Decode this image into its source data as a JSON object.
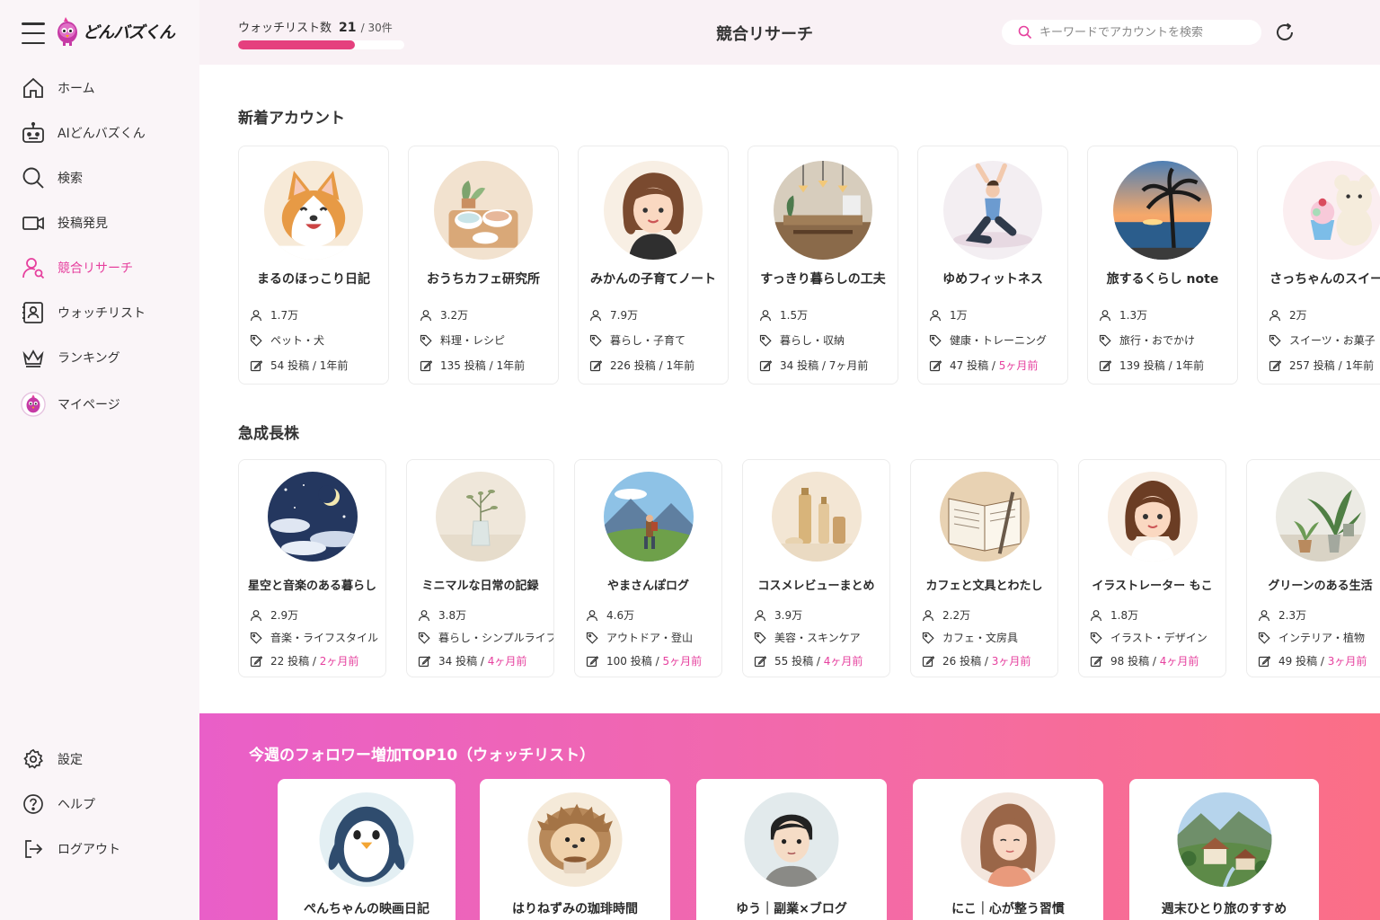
{
  "app": {
    "logo_text": "どんバズくん"
  },
  "sidebar": {
    "items": [
      {
        "label": "ホーム",
        "icon": "home-icon"
      },
      {
        "label": "AIどんバズくん",
        "icon": "robot-icon"
      },
      {
        "label": "検索",
        "icon": "search-icon"
      },
      {
        "label": "投稿発見",
        "icon": "video-icon"
      },
      {
        "label": "競合リサーチ",
        "icon": "user-search-icon",
        "active": true
      },
      {
        "label": "ウォッチリスト",
        "icon": "contact-book-icon"
      },
      {
        "label": "ランキング",
        "icon": "crown-icon"
      },
      {
        "label": "マイページ",
        "icon": "avatar-icon"
      }
    ],
    "bottom_items": [
      {
        "label": "設定",
        "icon": "gear-icon"
      },
      {
        "label": "ヘルプ",
        "icon": "help-icon"
      },
      {
        "label": "ログアウト",
        "icon": "logout-icon"
      }
    ]
  },
  "header": {
    "watch_label": "ウォッチリスト数",
    "watch_count": "21",
    "watch_total": "/ 30件",
    "watch_progress": 0.7,
    "title": "競合リサーチ",
    "search_placeholder": "キーワードでアカウントを検索"
  },
  "new_accounts": {
    "title": "新着アカウント",
    "cards": [
      {
        "name": "まるのほっこり日記",
        "followers": "1.7万",
        "tags": "ペット・犬",
        "posts": "54 投稿",
        "sep": "/",
        "age": "1年前",
        "age_highlight": false
      },
      {
        "name": "おうちカフェ研究所",
        "followers": "3.2万",
        "tags": "料理・レシピ",
        "posts": "135 投稿",
        "sep": "/",
        "age": "1年前",
        "age_highlight": false
      },
      {
        "name": "みかんの子育てノート",
        "followers": "7.9万",
        "tags": "暮らし・子育て",
        "posts": "226 投稿",
        "sep": "/",
        "age": "1年前",
        "age_highlight": false
      },
      {
        "name": "すっきり暮らしの工夫",
        "followers": "1.5万",
        "tags": "暮らし・収納",
        "posts": "34 投稿",
        "sep": "/",
        "age": "7ヶ月前",
        "age_highlight": false
      },
      {
        "name": "ゆめフィットネス",
        "followers": "1万",
        "tags": "健康・トレーニング",
        "posts": "47 投稿",
        "sep": "/",
        "age": "5ヶ月前",
        "age_highlight": true
      },
      {
        "name": "旅するくらし note",
        "followers": "1.3万",
        "tags": "旅行・おでかけ",
        "posts": "139 投稿",
        "sep": "/",
        "age": "1年前",
        "age_highlight": false
      },
      {
        "name": "さっちゃんのスイーツ",
        "followers": "2万",
        "tags": "スイーツ・お菓子",
        "posts": "257 投稿",
        "sep": "/",
        "age": "1年前",
        "age_highlight": false
      }
    ]
  },
  "rapid_growth": {
    "title": "急成長株",
    "cards": [
      {
        "name": "星空と音楽のある暮らし",
        "followers": "2.9万",
        "tags": "音楽・ライフスタイル",
        "posts": "22 投稿",
        "sep": "/",
        "age": "2ヶ月前",
        "age_highlight": true
      },
      {
        "name": "ミニマルな日常の記録",
        "followers": "3.8万",
        "tags": "暮らし・シンプルライフ",
        "posts": "34 投稿",
        "sep": "/",
        "age": "4ヶ月前",
        "age_highlight": true
      },
      {
        "name": "やまさんぽログ",
        "followers": "4.6万",
        "tags": "アウトドア・登山",
        "posts": "100 投稿",
        "sep": "/",
        "age": "5ヶ月前",
        "age_highlight": true
      },
      {
        "name": "コスメレビューまとめ",
        "followers": "3.9万",
        "tags": "美容・スキンケア",
        "posts": "55 投稿",
        "sep": "/",
        "age": "4ヶ月前",
        "age_highlight": true
      },
      {
        "name": "カフェと文具とわたし",
        "followers": "2.2万",
        "tags": "カフェ・文房具",
        "posts": "26 投稿",
        "sep": "/",
        "age": "3ヶ月前",
        "age_highlight": true
      },
      {
        "name": "イラストレーター もこ",
        "followers": "1.8万",
        "tags": "イラスト・デザイン",
        "posts": "98 投稿",
        "sep": "/",
        "age": "4ヶ月前",
        "age_highlight": true
      },
      {
        "name": "グリーンのある生活",
        "followers": "2.3万",
        "tags": "インテリア・植物",
        "posts": "49 投稿",
        "sep": "/",
        "age": "3ヶ月前",
        "age_highlight": true
      }
    ]
  },
  "top10": {
    "title": "今週のフォロワー増加TOP10（ウォッチリスト）",
    "cards": [
      {
        "name": "ぺんちゃんの映画日記"
      },
      {
        "name": "はりねずみの珈琲時間"
      },
      {
        "name": "ゆう｜副業×ブログ"
      },
      {
        "name": "にこ｜心が整う習慣"
      },
      {
        "name": "週末ひとり旅のすすめ"
      }
    ]
  },
  "colors": {
    "accent": "#e6409e",
    "progress": "#e5407e",
    "band_start": "#e95fc8",
    "band_end": "#fb6f86"
  }
}
